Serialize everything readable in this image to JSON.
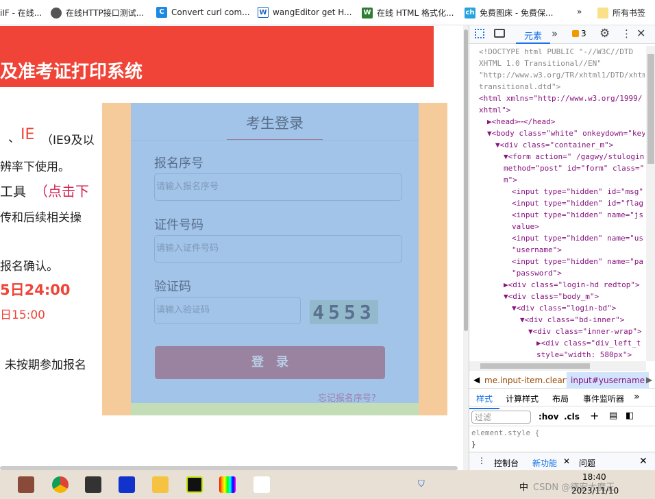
{
  "bookmarks": [
    {
      "label": "iIF - 在线...",
      "icon": "gif-icon"
    },
    {
      "label": "在线HTTP接口测试...",
      "icon": "globe-icon"
    },
    {
      "label": "Convert curl com...",
      "icon": "c-icon"
    },
    {
      "label": "wangEditor get H...",
      "icon": "w-icon"
    },
    {
      "label": "在线 HTML 格式化...",
      "icon": "html-icon"
    },
    {
      "label": "免费图床 - 免费保...",
      "icon": "ch-icon"
    }
  ],
  "bookmarks_more": "»",
  "bookmarks_folder": "所有书签",
  "page": {
    "title": "及准考证打印系统",
    "left_lines": [
      "、",
      "IE",
      "（IE9及以",
      "辨率下使用。",
      "工具",
      "（点击下",
      "传和后续相关操",
      "报名确认。",
      "5日24:00",
      "日15:00",
      "未按期参加报名"
    ],
    "login": {
      "heading": "考生登录",
      "fields": [
        {
          "label": "报名序号",
          "placeholder": "请输入报名序号"
        },
        {
          "label": "证件号码",
          "placeholder": "请输入证件号码"
        },
        {
          "label": "验证码",
          "placeholder": "请输入验证码"
        }
      ],
      "captcha": "4553",
      "submit": "登　录",
      "forgot": "忘记报名序号?"
    }
  },
  "devtools": {
    "tabs": {
      "elements": "元素",
      "more": "»",
      "issues_count": "3"
    },
    "code_lines": [
      "<!DOCTYPE html PUBLIC \"-//W3C//DTD",
      "XHTML 1.0 Transitional//EN\"",
      "\"http://www.w3.org/TR/xhtml1/DTD/xhtm",
      "transitional.dtd\">",
      "<html xmlns=\"http://www.w3.org/1999/",
      "xhtml\">",
      "▶<head>⋯</head>",
      "▼<body class=\"white\" onkeydown=\"keyL",
      "▼<div class=\"container_m\">",
      "▼<form action=\" /gagwy/stulogin/",
      "method=\"post\" id=\"form\" class=\"",
      "m\">",
      "<input type=\"hidden\" id=\"msg\"",
      "<input type=\"hidden\" id=\"flag",
      "<input type=\"hidden\" name=\"js",
      "value>",
      "<input type=\"hidden\" name=\"us",
      "\"username\">",
      "<input type=\"hidden\" name=\"pa",
      "\"password\">",
      "▶<div class=\"login-hd redtop\">",
      "▼<div class=\"body_m\">",
      "▼<div class=\"login-bd\">",
      "▼<div class=\"bd-inner\">",
      "▼<div class=\"inner-wrap\">",
      "▶<div class=\"div_left_t",
      "style=\"width: 580px\">"
    ],
    "breadcrumbs": [
      "me.input-item.clearfix",
      "input#yusername"
    ],
    "style_tabs": [
      "样式",
      "计算样式",
      "布局",
      "事件监听器",
      "»"
    ],
    "filter_placeholder": "过滤",
    "hov": ":hov",
    "cls": ".cls",
    "element_style": "element.style {",
    "close_brace": "}",
    "drawer_tabs": [
      "控制台",
      "新功能",
      "问题"
    ]
  },
  "taskbar": {
    "time": "18:40",
    "date": "2023/11/10",
    "ime": "中",
    "watermark": "CSDN @德宏大魔王"
  }
}
